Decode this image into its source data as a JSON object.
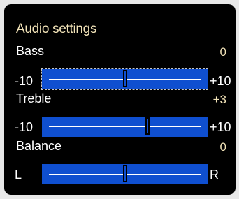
{
  "dialog": {
    "title": "Audio settings"
  },
  "bass": {
    "label": "Bass",
    "value": "0",
    "min_label": "-10",
    "max_label": "+10",
    "level": 0.5
  },
  "treble": {
    "label": "Treble",
    "value": "+3",
    "min_label": "-10",
    "max_label": "+10",
    "level": 0.65
  },
  "balance": {
    "label": "Balance",
    "value": "0",
    "min_label": "L",
    "max_label": "R",
    "level": 0.5
  },
  "colors": {
    "panel_background": "#000000",
    "slider_fill": "#0f4fd0",
    "accent_text": "#f2e3b8"
  }
}
